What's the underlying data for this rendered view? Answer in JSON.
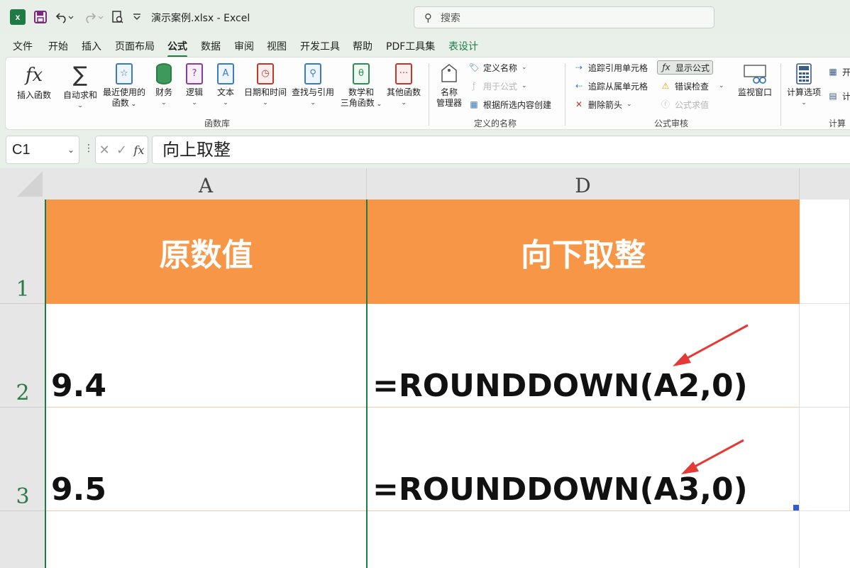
{
  "titlebar": {
    "app_icon_letter": "x",
    "document_title": "演示案例.xlsx  -  Excel",
    "search_placeholder": "搜索"
  },
  "menu": {
    "tabs": [
      "文件",
      "开始",
      "插入",
      "页面布局",
      "公式",
      "数据",
      "审阅",
      "视图",
      "开发工具",
      "帮助",
      "PDF工具集",
      "表设计"
    ],
    "active_tab": "公式"
  },
  "ribbon": {
    "function_library": {
      "group_label": "函数库",
      "insert_function": "插入函数",
      "autosum": "自动求和",
      "recent_line1": "最近使用的",
      "recent_line2": "函数",
      "financial": "财务",
      "logical": "逻辑",
      "text": "文本",
      "datetime": "日期和时间",
      "lookup": "查找与引用",
      "math_line1": "数学和",
      "math_line2": "三角函数",
      "more": "其他函数"
    },
    "defined_names": {
      "group_label": "定义的名称",
      "name_manager_line1": "名称",
      "name_manager_line2": "管理器",
      "define_name": "定义名称",
      "use_in_formula": "用于公式",
      "create_from_selection": "根据所选内容创建"
    },
    "formula_auditing": {
      "group_label": "公式审核",
      "trace_precedents": "追踪引用单元格",
      "trace_dependents": "追踪从属单元格",
      "remove_arrows": "删除箭头",
      "show_formulas": "显示公式",
      "error_checking": "错误检查",
      "evaluate_formula": "公式求值",
      "watch_window": "监视窗口"
    },
    "calculation": {
      "group_label": "计算",
      "calc_options": "计算选项",
      "calc_now": "开",
      "calc_sheet": "计"
    }
  },
  "formula_bar": {
    "name_box": "C1",
    "content": "向上取整"
  },
  "sheet": {
    "columns": [
      "A",
      "D"
    ],
    "rows": [
      "1",
      "2",
      "3"
    ],
    "header_cells": [
      "原数值",
      "向下取整"
    ],
    "values_col_a": [
      "9.4",
      "9.5"
    ],
    "formulas_col_d": [
      "=ROUNDDOWN(A2,0)",
      "=ROUNDDOWN(A3,0)"
    ],
    "header_fill_color": "#f79646",
    "annotation_arrow_color": "#e53935"
  }
}
